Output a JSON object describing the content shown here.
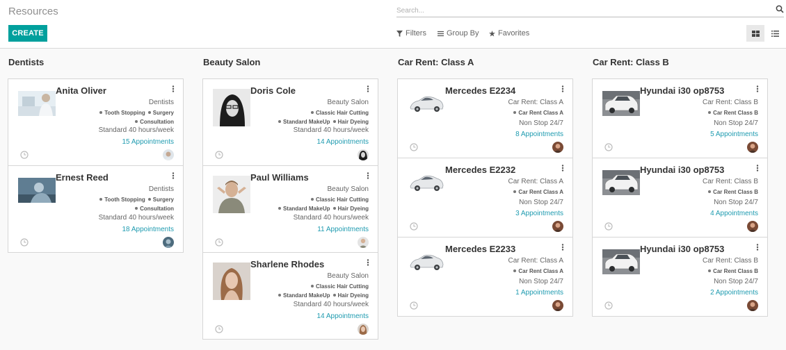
{
  "app": {
    "title": "Resources",
    "create_label": "CREATE"
  },
  "search": {
    "placeholder": "Search..."
  },
  "filters": {
    "filters_label": "Filters",
    "groupby_label": "Group By",
    "favorites_label": "Favorites"
  },
  "colors": {
    "accent": "#00a09d",
    "link": "#1f9bb0"
  },
  "columns": [
    {
      "title": "Dentists",
      "cards": [
        {
          "name": "Anita Oliver",
          "category": "Dentists",
          "tags": [
            "Tooth Stopping",
            "Surgery",
            "Consultation"
          ],
          "hours": "Standard 40 hours/week",
          "appointments": "15 Appointments"
        },
        {
          "name": "Ernest Reed",
          "category": "Dentists",
          "tags": [
            "Tooth Stopping",
            "Surgery",
            "Consultation"
          ],
          "hours": "Standard 40 hours/week",
          "appointments": "18 Appointments"
        }
      ]
    },
    {
      "title": "Beauty Salon",
      "cards": [
        {
          "name": "Doris Cole",
          "category": "Beauty Salon",
          "tags": [
            "Classic Hair Cutting",
            "Standard MakeUp",
            "Hair Dyeing"
          ],
          "hours": "Standard 40 hours/week",
          "appointments": "14 Appointments"
        },
        {
          "name": "Paul Williams",
          "category": "Beauty Salon",
          "tags": [
            "Classic Hair Cutting",
            "Standard MakeUp",
            "Hair Dyeing"
          ],
          "hours": "Standard 40 hours/week",
          "appointments": "11 Appointments"
        },
        {
          "name": "Sharlene Rhodes",
          "category": "Beauty Salon",
          "tags": [
            "Classic Hair Cutting",
            "Standard MakeUp",
            "Hair Dyeing"
          ],
          "hours": "Standard 40 hours/week",
          "appointments": "14 Appointments"
        }
      ]
    },
    {
      "title": "Car Rent: Class A",
      "cards": [
        {
          "name": "Mercedes E2234",
          "category": "Car Rent: Class A",
          "tags": [
            "Car Rent Class A"
          ],
          "hours": "Non Stop 24/7",
          "appointments": "8 Appointments"
        },
        {
          "name": "Mercedes E2232",
          "category": "Car Rent: Class A",
          "tags": [
            "Car Rent Class A"
          ],
          "hours": "Non Stop 24/7",
          "appointments": "3 Appointments"
        },
        {
          "name": "Mercedes E2233",
          "category": "Car Rent: Class A",
          "tags": [
            "Car Rent Class A"
          ],
          "hours": "Non Stop 24/7",
          "appointments": "1 Appointments"
        }
      ]
    },
    {
      "title": "Car Rent: Class B",
      "cards": [
        {
          "name": "Hyundai i30 op8753",
          "category": "Car Rent: Class B",
          "tags": [
            "Car Rent Class B"
          ],
          "hours": "Non Stop 24/7",
          "appointments": "5 Appointments"
        },
        {
          "name": "Hyundai i30 op8753",
          "category": "Car Rent: Class B",
          "tags": [
            "Car Rent Class B"
          ],
          "hours": "Non Stop 24/7",
          "appointments": "4 Appointments"
        },
        {
          "name": "Hyundai i30 op8753",
          "category": "Car Rent: Class B",
          "tags": [
            "Car Rent Class B"
          ],
          "hours": "Non Stop 24/7",
          "appointments": "2 Appointments"
        }
      ]
    }
  ]
}
